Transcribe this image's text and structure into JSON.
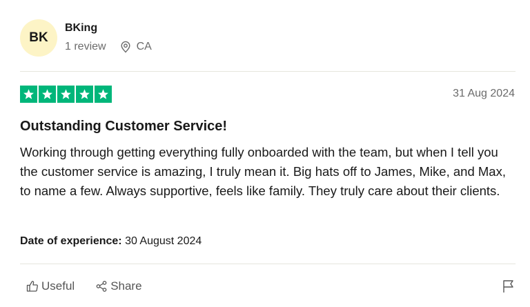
{
  "reviewer": {
    "initials": "BK",
    "name": "BKing",
    "review_count": "1 review",
    "location": "CA",
    "avatar_color": "#fdf4c6"
  },
  "review": {
    "rating": 5,
    "max_rating": 5,
    "star_color": "#00b67a",
    "date": "31 Aug 2024",
    "title": "Outstanding Customer Service!",
    "body": "Working through getting everything fully onboarded with the team, but when I tell you the customer service is amazing, I truly mean it. Big hats off to James, Mike, and Max, to name a few. Always supportive, feels like family. They truly care about their clients.",
    "experience_label": "Date of experience:",
    "experience_date": "30 August 2024"
  },
  "actions": {
    "useful_label": "Useful",
    "share_label": "Share"
  },
  "icons": {
    "location": "location-pin-icon",
    "useful": "thumbs-up-icon",
    "share": "share-icon",
    "report": "flag-icon",
    "star": "star-icon"
  }
}
